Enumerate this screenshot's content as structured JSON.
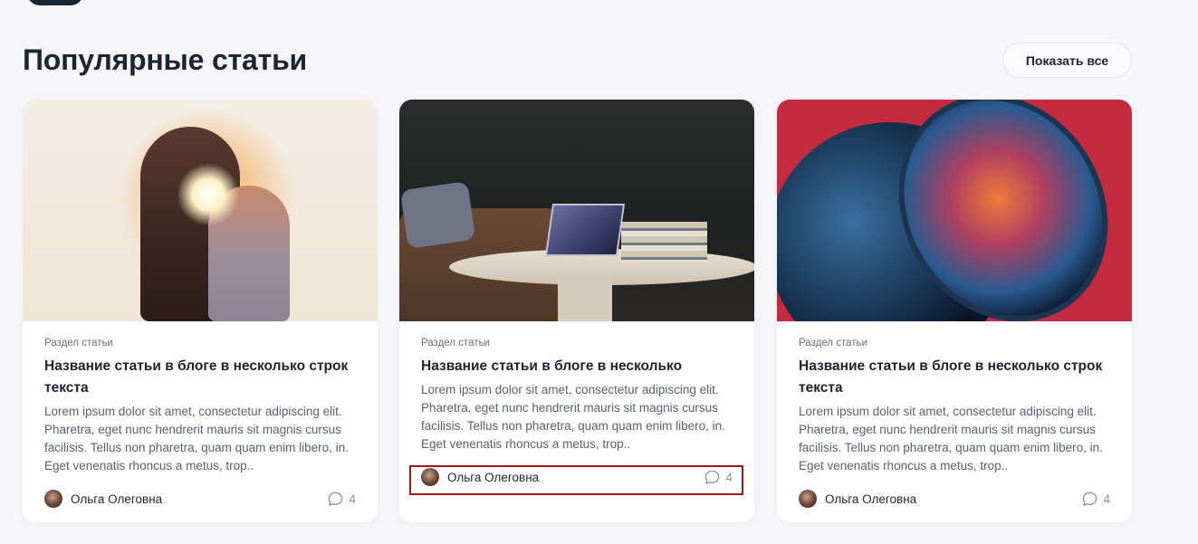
{
  "section": {
    "title": "Популярные статьи",
    "show_all_label": "Показать все"
  },
  "cards": [
    {
      "category": "Раздел статьи",
      "title": "Название статьи в блоге в несколько строк текста",
      "excerpt": "Lorem ipsum dolor sit amet, consectetur adipiscing elit. Pharetra, eget nunc hendrerit mauris sit magnis cursus facilisis. Tellus non pharetra, quam quam enim libero, in. Eget venenatis rhoncus a metus, trop..",
      "author": "Ольга Олеговна",
      "comments": "4"
    },
    {
      "category": "Раздел статьи",
      "title": "Название статьи в блоге в несколько",
      "excerpt": "Lorem ipsum dolor sit amet, consectetur adipiscing elit. Pharetra, eget nunc hendrerit mauris sit magnis cursus facilisis. Tellus non pharetra, quam quam enim libero, in. Eget venenatis rhoncus a metus, trop..",
      "author": "Ольга Олеговна",
      "comments": "4"
    },
    {
      "category": "Раздел статьи",
      "title": "Название статьи в блоге в несколько строк текста",
      "excerpt": "Lorem ipsum dolor sit amet, consectetur adipiscing elit. Pharetra, eget nunc hendrerit mauris sit magnis cursus facilisis. Tellus non pharetra, quam quam enim libero, in. Eget venenatis rhoncus a metus, trop..",
      "author": "Ольга Олеговна",
      "comments": "4"
    }
  ],
  "icons": {
    "comment": "comment-bubble-icon",
    "avatar": "author-avatar"
  },
  "colors": {
    "background": "#f7f7fb",
    "text_primary": "#1d2432",
    "text_secondary": "#5a6072",
    "highlight_border": "#a01818"
  }
}
